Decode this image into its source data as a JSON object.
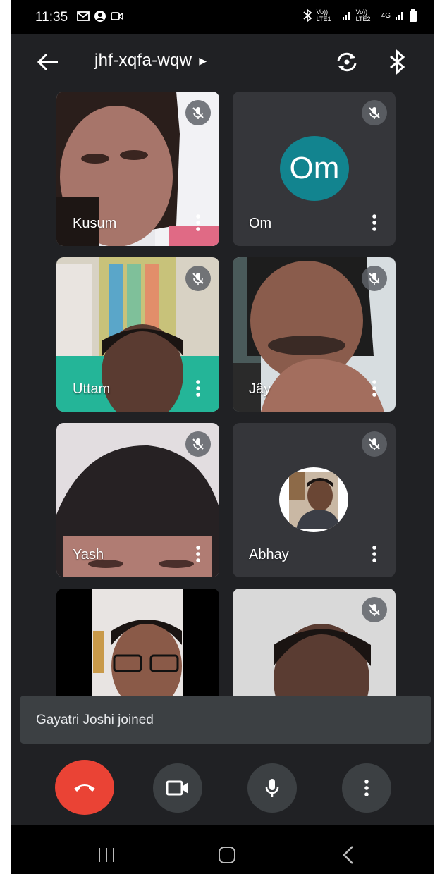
{
  "status": {
    "time": "11:35",
    "net1": "Vo)) LTE1",
    "net2": "Vo)) LTE2",
    "net3": "4G"
  },
  "meeting": {
    "code": "jhf-xqfa-wqw"
  },
  "participants": [
    {
      "name": "Kusum",
      "muted": true
    },
    {
      "name": "Om",
      "muted": true,
      "avatar_initials": "Om",
      "avatar_color": "#12848f"
    },
    {
      "name": "Uttam",
      "muted": true
    },
    {
      "name": "Jây",
      "muted": true
    },
    {
      "name": "Yash",
      "muted": true
    },
    {
      "name": "Abhay",
      "muted": true
    },
    {
      "name": "",
      "muted": false
    },
    {
      "name": "",
      "muted": true
    }
  ],
  "toast": {
    "message": "Gayatri Joshi joined"
  },
  "controls": {
    "end_call_color": "#ea4335"
  },
  "colors": {
    "background": "#202124",
    "tile": "#3c4043",
    "accent_avatar": "#12848f"
  }
}
